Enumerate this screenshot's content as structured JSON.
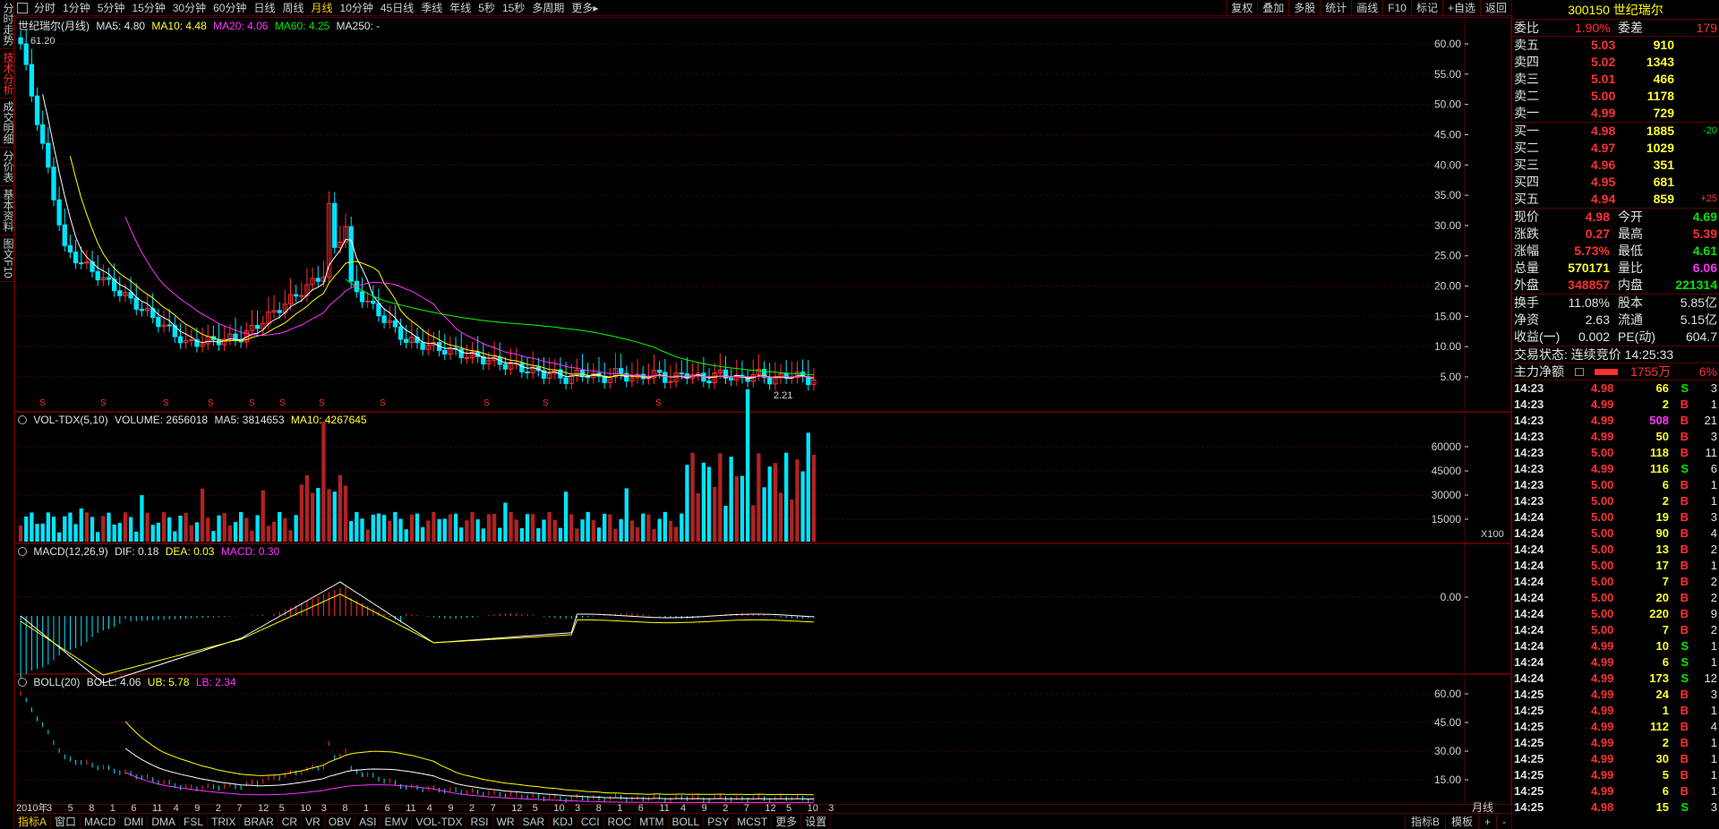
{
  "left_tabs": [
    "分时走势",
    "技术分析",
    "成交明细",
    "分价表",
    "基本资料",
    "图文F10"
  ],
  "left_active": 1,
  "toolbar": {
    "periods": [
      "分时",
      "1分钟",
      "5分钟",
      "15分钟",
      "30分钟",
      "60分钟",
      "日线",
      "周线",
      "月线",
      "10分钟",
      "45日线",
      "季线",
      "年线",
      "5秒",
      "15秒",
      "多周期",
      "更多▸"
    ],
    "active": 8,
    "right": [
      "复权",
      "叠加",
      "多股",
      "统计",
      "画线",
      "F10",
      "标记",
      "+自选",
      "返回"
    ]
  },
  "main_pane": {
    "title": "世纪瑞尔(月线)",
    "ma5": "MA5: 4.80",
    "ma10": "MA10: 4.48",
    "ma20": "MA20: 4.06",
    "ma60": "MA60: 4.25",
    "ma250": "MA250: -",
    "high_marker": "61.20",
    "low_marker": "2.21",
    "y_ticks": [
      "60.00",
      "55.00",
      "50.00",
      "45.00",
      "40.00",
      "35.00",
      "30.00",
      "25.00",
      "20.00",
      "15.00",
      "10.00",
      "5.00"
    ]
  },
  "vol_pane": {
    "name": "VOL-TDX(5,10)",
    "volume": "VOLUME: 2656018",
    "ma5": "MA5: 3814653",
    "ma10": "MA10: 4267645",
    "y_ticks": [
      "60000",
      "45000",
      "30000",
      "15000"
    ],
    "unit": "X100"
  },
  "macd_pane": {
    "name": "MACD(12,26,9)",
    "dif": "DIF: 0.18",
    "dea": "DEA: 0.03",
    "macd": "MACD: 0.30",
    "y_ticks": [
      "0.00"
    ]
  },
  "boll_pane": {
    "name": "BOLL(20)",
    "boll": "BOLL: 4.06",
    "ub": "UB: 5.78",
    "lb": "LB: 2.34",
    "y_ticks": [
      "60.00",
      "45.00",
      "30.00",
      "15.00"
    ]
  },
  "x_axis": {
    "labels": [
      "2010年",
      "3",
      "5",
      "8",
      "1",
      "6",
      "11",
      "4",
      "9",
      "2",
      "7",
      "12",
      "5",
      "10",
      "3",
      "8",
      "1",
      "6",
      "11",
      "4",
      "9",
      "2",
      "7",
      "12",
      "5",
      "10",
      "3",
      "8",
      "1",
      "6",
      "11",
      "4",
      "9",
      "2",
      "7",
      "12",
      "5",
      "10",
      "3"
    ],
    "period": "月线"
  },
  "bottom_tabs": [
    "指标A",
    "窗口",
    "MACD",
    "DMI",
    "DMA",
    "FSL",
    "TRIX",
    "BRAR",
    "CR",
    "VR",
    "OBV",
    "ASI",
    "EMV",
    "VOL-TDX",
    "RSI",
    "WR",
    "SAR",
    "KDJ",
    "CCI",
    "ROC",
    "MTM",
    "BOLL",
    "PSY",
    "MCST",
    "更多",
    "设置"
  ],
  "bottom_right": [
    "指标B",
    "模板",
    "+",
    "-"
  ],
  "quote": {
    "code": "300150",
    "name": "世纪瑞尔",
    "weibi_label": "委比",
    "weibi": "1.90%",
    "weicha_label": "委差",
    "weicha": "179",
    "asks": [
      {
        "label": "卖五",
        "price": "5.03",
        "vol": "910",
        "chg": ""
      },
      {
        "label": "卖四",
        "price": "5.02",
        "vol": "1343",
        "chg": ""
      },
      {
        "label": "卖三",
        "price": "5.01",
        "vol": "466",
        "chg": ""
      },
      {
        "label": "卖二",
        "price": "5.00",
        "vol": "1178",
        "chg": ""
      },
      {
        "label": "卖一",
        "price": "4.99",
        "vol": "729",
        "chg": ""
      }
    ],
    "bids": [
      {
        "label": "买一",
        "price": "4.98",
        "vol": "1885",
        "chg": "-20"
      },
      {
        "label": "买二",
        "price": "4.97",
        "vol": "1029",
        "chg": ""
      },
      {
        "label": "买三",
        "price": "4.96",
        "vol": "351",
        "chg": ""
      },
      {
        "label": "买四",
        "price": "4.95",
        "vol": "681",
        "chg": ""
      },
      {
        "label": "买五",
        "price": "4.94",
        "vol": "859",
        "chg": "+25"
      }
    ],
    "stats1": [
      {
        "l1": "现价",
        "v1": "4.98",
        "c1": "red",
        "l2": "今开",
        "v2": "4.69",
        "c2": "green"
      },
      {
        "l1": "涨跌",
        "v1": "0.27",
        "c1": "red",
        "l2": "最高",
        "v2": "5.39",
        "c2": "red"
      },
      {
        "l1": "涨幅",
        "v1": "5.73%",
        "c1": "red",
        "l2": "最低",
        "v2": "4.61",
        "c2": "green"
      },
      {
        "l1": "总量",
        "v1": "570171",
        "c1": "yellow",
        "l2": "量比",
        "v2": "6.06",
        "c2": "magenta"
      },
      {
        "l1": "外盘",
        "v1": "348857",
        "c1": "red",
        "l2": "内盘",
        "v2": "221314",
        "c2": "green"
      }
    ],
    "stats2": [
      {
        "l1": "换手",
        "v1": "11.08%",
        "l2": "股本",
        "v2": "5.85亿"
      },
      {
        "l1": "净资",
        "v1": "2.63",
        "l2": "流通",
        "v2": "5.15亿"
      },
      {
        "l1": "收益(一)",
        "v1": "0.002",
        "l2": "PE(动)",
        "v2": "604.7"
      }
    ],
    "trade_status": "交易状态: 连续竞价 14:25:33",
    "main_flow_label": "主力净额",
    "main_flow_value": "1755万",
    "main_flow_pct": "6%",
    "ticks": [
      {
        "t": "14:23",
        "p": "4.98",
        "v": "66",
        "s": "S",
        "n": "3"
      },
      {
        "t": "14:23",
        "p": "4.99",
        "v": "2",
        "s": "B",
        "n": "1"
      },
      {
        "t": "14:23",
        "p": "4.99",
        "v": "508",
        "s": "B",
        "n": "21"
      },
      {
        "t": "14:23",
        "p": "4.99",
        "v": "50",
        "s": "B",
        "n": "3"
      },
      {
        "t": "14:23",
        "p": "5.00",
        "v": "118",
        "s": "B",
        "n": "11"
      },
      {
        "t": "14:23",
        "p": "4.99",
        "v": "116",
        "s": "S",
        "n": "6"
      },
      {
        "t": "14:23",
        "p": "5.00",
        "v": "6",
        "s": "B",
        "n": "1"
      },
      {
        "t": "14:23",
        "p": "5.00",
        "v": "2",
        "s": "B",
        "n": "1"
      },
      {
        "t": "14:24",
        "p": "5.00",
        "v": "19",
        "s": "B",
        "n": "3"
      },
      {
        "t": "14:24",
        "p": "5.00",
        "v": "90",
        "s": "B",
        "n": "4"
      },
      {
        "t": "14:24",
        "p": "5.00",
        "v": "13",
        "s": "B",
        "n": "2"
      },
      {
        "t": "14:24",
        "p": "5.00",
        "v": "17",
        "s": "B",
        "n": "1"
      },
      {
        "t": "14:24",
        "p": "5.00",
        "v": "7",
        "s": "B",
        "n": "2"
      },
      {
        "t": "14:24",
        "p": "5.00",
        "v": "20",
        "s": "B",
        "n": "2"
      },
      {
        "t": "14:24",
        "p": "5.00",
        "v": "220",
        "s": "B",
        "n": "9"
      },
      {
        "t": "14:24",
        "p": "5.00",
        "v": "7",
        "s": "B",
        "n": "2"
      },
      {
        "t": "14:24",
        "p": "4.99",
        "v": "10",
        "s": "S",
        "n": "1"
      },
      {
        "t": "14:24",
        "p": "4.99",
        "v": "6",
        "s": "S",
        "n": "1"
      },
      {
        "t": "14:24",
        "p": "4.99",
        "v": "173",
        "s": "S",
        "n": "12"
      },
      {
        "t": "14:25",
        "p": "4.99",
        "v": "24",
        "s": "B",
        "n": "3"
      },
      {
        "t": "14:25",
        "p": "4.99",
        "v": "1",
        "s": "B",
        "n": "1"
      },
      {
        "t": "14:25",
        "p": "4.99",
        "v": "112",
        "s": "B",
        "n": "4"
      },
      {
        "t": "14:25",
        "p": "4.99",
        "v": "2",
        "s": "B",
        "n": "1"
      },
      {
        "t": "14:25",
        "p": "4.99",
        "v": "30",
        "s": "B",
        "n": "1"
      },
      {
        "t": "14:25",
        "p": "4.99",
        "v": "5",
        "s": "B",
        "n": "1"
      },
      {
        "t": "14:25",
        "p": "4.99",
        "v": "6",
        "s": "B",
        "n": "1"
      },
      {
        "t": "14:25",
        "p": "4.98",
        "v": "15",
        "s": "S",
        "n": "3"
      }
    ]
  },
  "colors": {
    "up": "#ff3030",
    "down": "#00e5ff",
    "ma5": "#ffffff",
    "ma10": "#ffff00",
    "ma20": "#ff33ff",
    "ma60": "#00ff00",
    "grid": "#5a0000"
  }
}
